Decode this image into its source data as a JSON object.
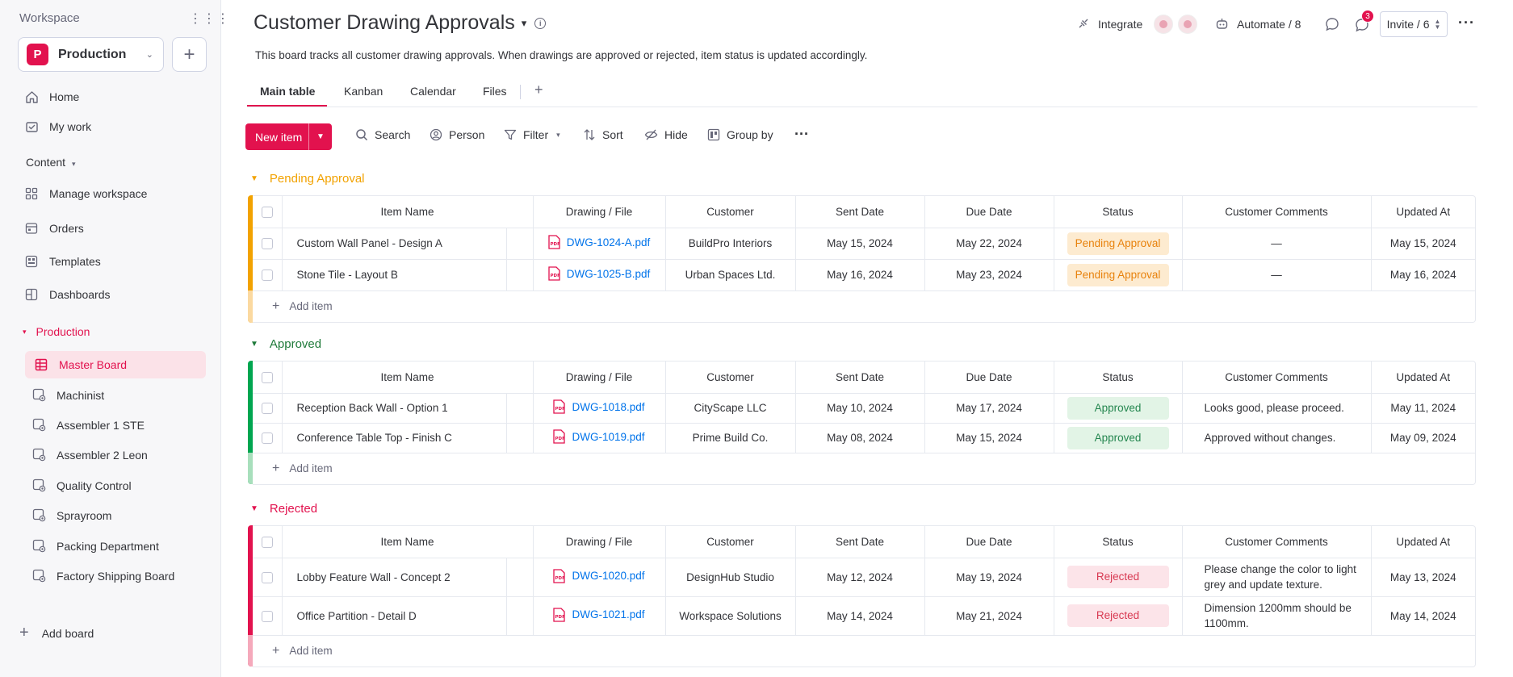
{
  "sidebar": {
    "workspace_label": "Workspace",
    "workspace_badge": "P",
    "workspace_name": "Production",
    "nav": [
      {
        "label": "Home",
        "icon": "home-icon"
      },
      {
        "label": "My work",
        "icon": "my-work-icon"
      }
    ],
    "content_label": "Content",
    "content_items": [
      {
        "label": "Manage workspace",
        "icon": "grid-icon"
      },
      {
        "label": "Orders",
        "icon": "orders-icon"
      },
      {
        "label": "Templates",
        "icon": "templates-icon"
      },
      {
        "label": "Dashboards",
        "icon": "dashboard-icon"
      }
    ],
    "folder_label": "Production",
    "active_board": "Master Board",
    "boards": [
      "Machinist",
      "Assembler 1 STE",
      "Assembler 2 Leon",
      "Quality Control",
      "Sprayroom",
      "Packing Department",
      "Factory Shipping Board"
    ],
    "add_board": "Add board"
  },
  "header": {
    "title": "Customer Drawing Approvals",
    "description": "This board tracks all customer drawing approvals. When drawings are approved or rejected, item status is updated accordingly.",
    "integrate": "Integrate",
    "automate": "Automate / 8",
    "notifications": "3",
    "invite": "Invite / 6"
  },
  "tabs": [
    "Main table",
    "Kanban",
    "Calendar",
    "Files"
  ],
  "toolbar": {
    "new_item": "New item",
    "search": "Search",
    "person": "Person",
    "filter": "Filter",
    "sort": "Sort",
    "hide": "Hide",
    "group_by": "Group by"
  },
  "columns": [
    "Item Name",
    "Drawing / File",
    "Customer",
    "Sent Date",
    "Due Date",
    "Status",
    "Customer Comments",
    "Updated At"
  ],
  "add_item": "Add item",
  "colors": {
    "accent": "#e2124e",
    "pending": "#f2a200",
    "approved": "#00a650",
    "rejected": "#e2124e"
  },
  "groups": [
    {
      "title": "Pending Approval",
      "rows": [
        {
          "name": "Custom Wall Panel - Design A",
          "file": "DWG-1024-A.pdf",
          "customer": "BuildPro Interiors",
          "sent": "May 15, 2024",
          "due": "May 22, 2024",
          "status": "Pending Approval",
          "comment": "—",
          "updated": "May 15, 2024"
        },
        {
          "name": "Stone Tile - Layout B",
          "file": "DWG-1025-B.pdf",
          "customer": "Urban Spaces Ltd.",
          "sent": "May 16, 2024",
          "due": "May 23, 2024",
          "status": "Pending Approval",
          "comment": "—",
          "updated": "May 16, 2024"
        }
      ]
    },
    {
      "title": "Approved",
      "rows": [
        {
          "name": "Reception Back Wall - Option 1",
          "file": "DWG-1018.pdf",
          "customer": "CityScape LLC",
          "sent": "May 10, 2024",
          "due": "May 17, 2024",
          "status": "Approved",
          "comment": "Looks good, please proceed.",
          "updated": "May 11, 2024"
        },
        {
          "name": "Conference Table Top - Finish C",
          "file": "DWG-1019.pdf",
          "customer": "Prime Build Co.",
          "sent": "May 08, 2024",
          "due": "May 15, 2024",
          "status": "Approved",
          "comment": "Approved without changes.",
          "updated": "May 09, 2024"
        }
      ]
    },
    {
      "title": "Rejected",
      "rows": [
        {
          "name": "Lobby Feature Wall - Concept 2",
          "file": "DWG-1020.pdf",
          "customer": "DesignHub Studio",
          "sent": "May 12, 2024",
          "due": "May 19, 2024",
          "status": "Rejected",
          "comment": "Please change the color to light grey and update texture.",
          "updated": "May 13, 2024"
        },
        {
          "name": "Office Partition - Detail D",
          "file": "DWG-1021.pdf",
          "customer": "Workspace Solutions",
          "sent": "May 14, 2024",
          "due": "May 21, 2024",
          "status": "Rejected",
          "comment": "Dimension 1200mm should be 1100mm.",
          "updated": "May 14, 2024"
        }
      ]
    }
  ]
}
